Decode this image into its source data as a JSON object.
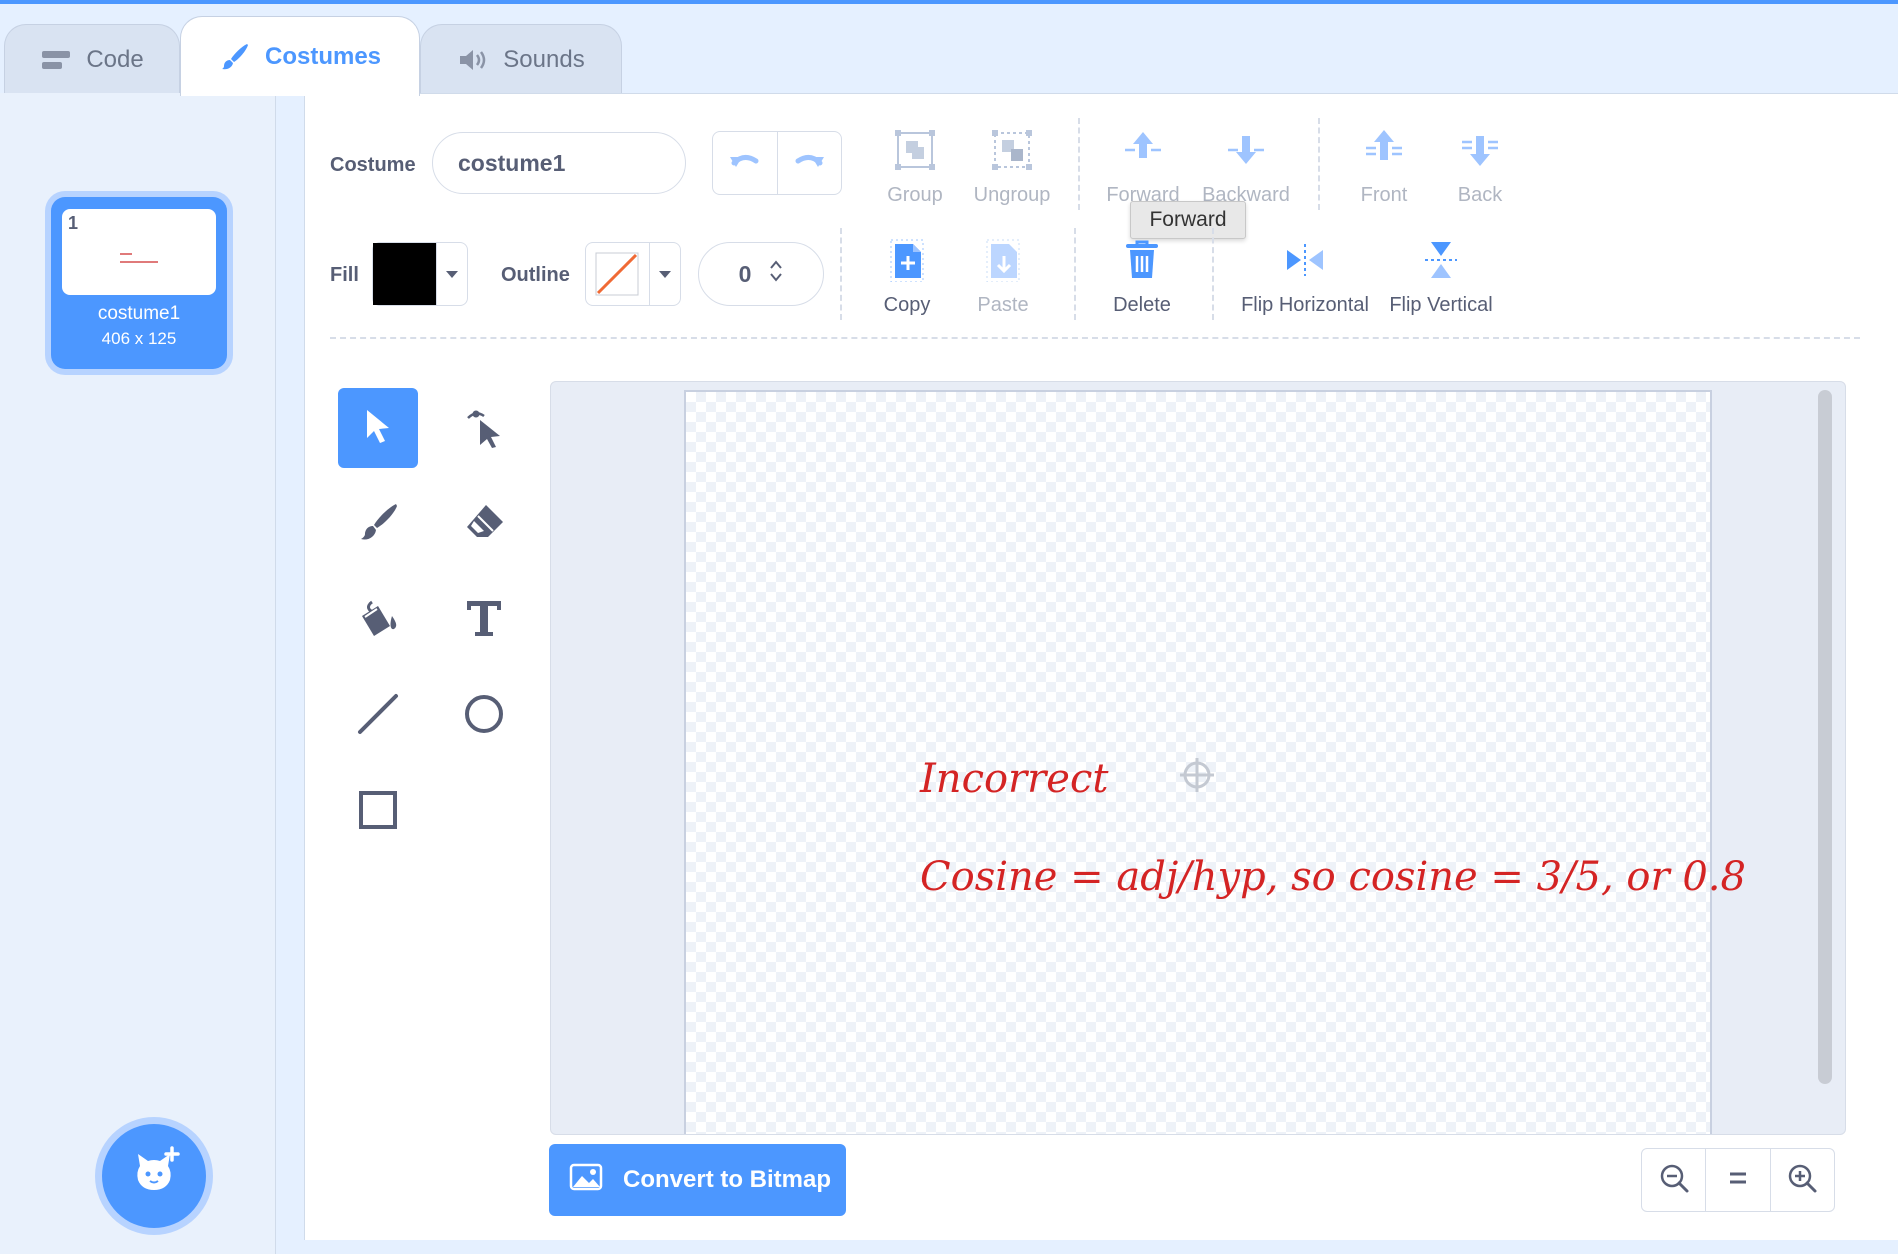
{
  "tabs": [
    {
      "label": "Code",
      "icon": "code-blocks-icon"
    },
    {
      "label": "Costumes",
      "icon": "paintbrush-icon"
    },
    {
      "label": "Sounds",
      "icon": "speaker-icon"
    }
  ],
  "costume_list": {
    "items": [
      {
        "number": "1",
        "name": "costume1",
        "size": "406 x 125"
      }
    ]
  },
  "toolbar": {
    "costume_label": "Costume",
    "costume_name": "costume1",
    "fill_label": "Fill",
    "outline_label": "Outline",
    "outline_width": "0",
    "group": "Group",
    "ungroup": "Ungroup",
    "forward": "Forward",
    "backward": "Backward",
    "front": "Front",
    "back": "Back",
    "copy": "Copy",
    "paste": "Paste",
    "delete": "Delete",
    "flip_horizontal": "Flip Horizontal",
    "flip_vertical": "Flip Vertical",
    "tooltip": "Forward"
  },
  "colors": {
    "accent": "#4c97ff",
    "fill": "#000000",
    "canvas_text": "#d42424"
  },
  "canvas": {
    "line1": "Incorrect",
    "line2": "Cosine = adj/hyp, so cosine = 3/5, or 0.8"
  },
  "bottom": {
    "convert_label": "Convert to Bitmap"
  }
}
